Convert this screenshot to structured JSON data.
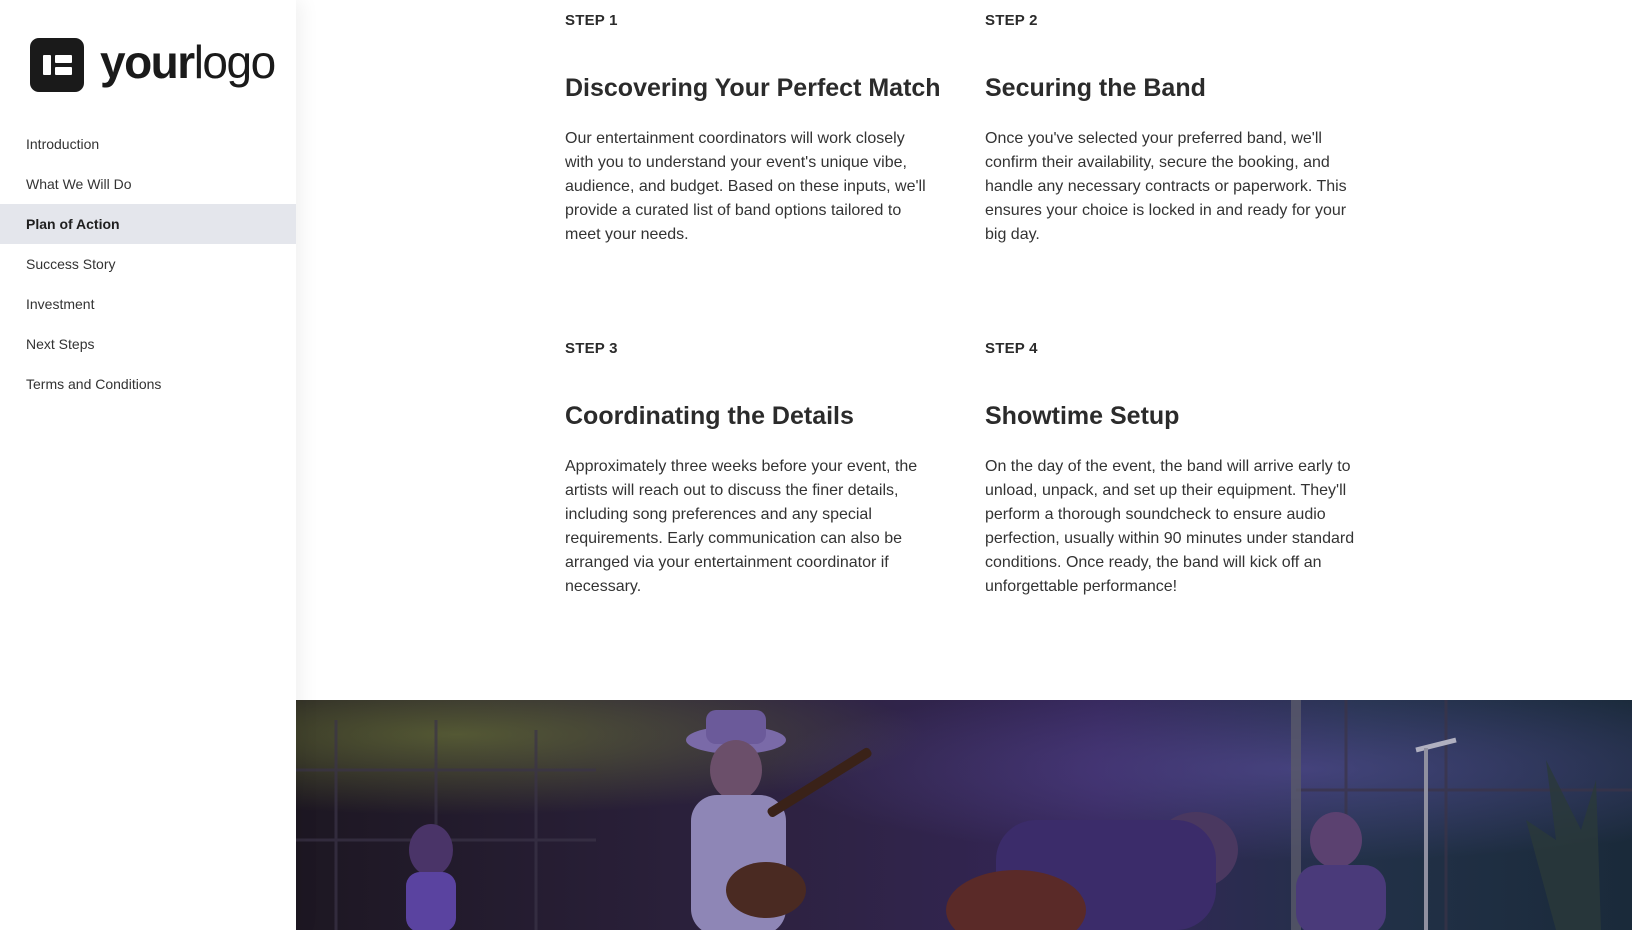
{
  "sidebar": {
    "logo": {
      "bold": "your",
      "light": "logo"
    },
    "items": [
      {
        "label": "Introduction",
        "active": false
      },
      {
        "label": "What We Will Do",
        "active": false
      },
      {
        "label": "Plan of Action",
        "active": true
      },
      {
        "label": "Success Story",
        "active": false
      },
      {
        "label": "Investment",
        "active": false
      },
      {
        "label": "Next Steps",
        "active": false
      },
      {
        "label": "Terms and Conditions",
        "active": false
      }
    ]
  },
  "steps": [
    {
      "label": "STEP 1",
      "title": "Discovering Your Perfect Match",
      "body": "Our entertainment coordinators will work closely with you to understand your event's unique vibe, audience, and budget. Based on these inputs, we'll provide a curated list of band options tailored to meet your needs."
    },
    {
      "label": "STEP 2",
      "title": "Securing the Band",
      "body": "Once you've selected your preferred band, we'll confirm their availability, secure the booking, and handle any necessary contracts or paperwork. This ensures your choice is locked in and ready for your big day."
    },
    {
      "label": "STEP 3",
      "title": "Coordinating the Details",
      "body": "Approximately three weeks before your event, the artists will reach out to discuss the finer details, including song preferences and any special requirements. Early communication can also be arranged via your entertainment coordinator if necessary."
    },
    {
      "label": "STEP 4",
      "title": "Showtime Setup",
      "body": "On the day of the event, the band will arrive early to unload, unpack, and set up their equipment. They'll perform a thorough soundcheck to ensure audio perfection, usually within 90 minutes under standard conditions. Once ready, the band will kick off an unforgettable performance!"
    }
  ]
}
